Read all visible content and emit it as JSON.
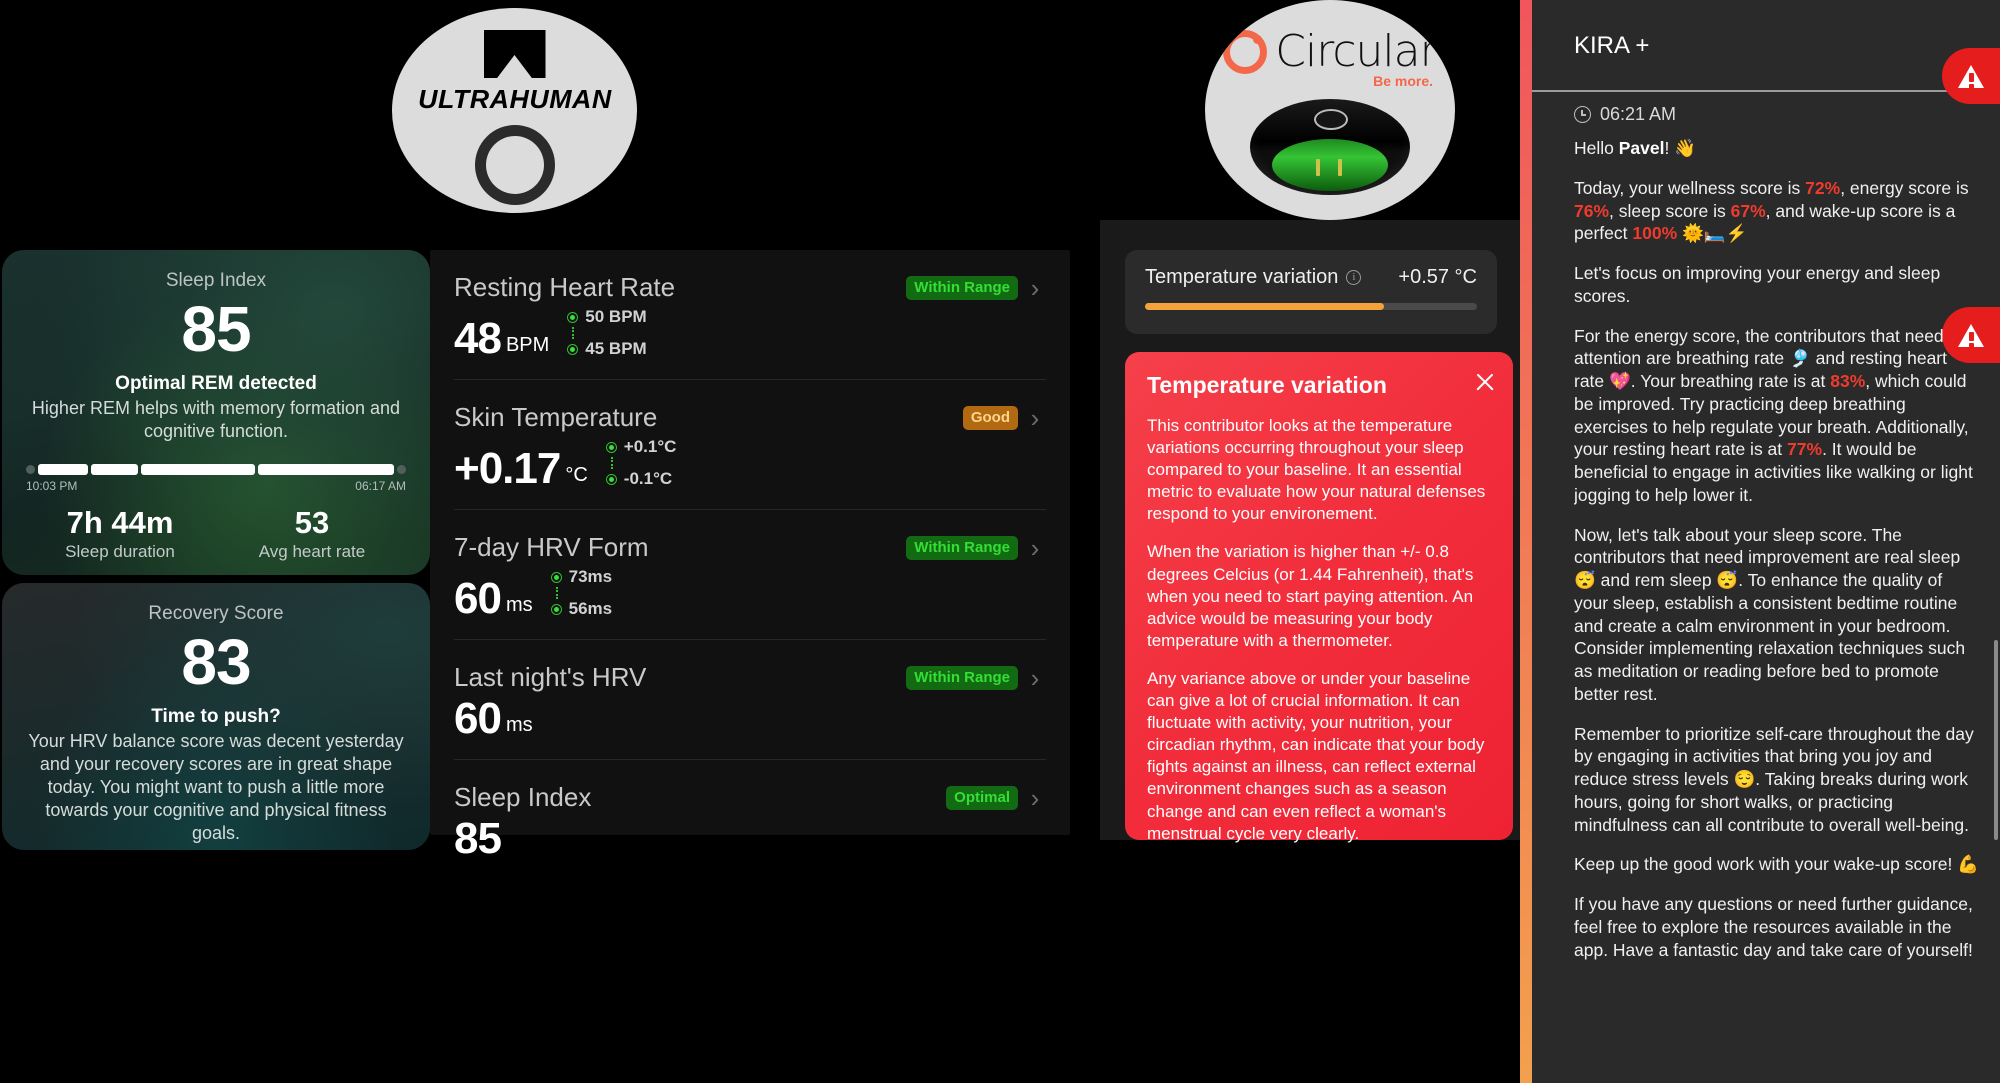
{
  "brands": {
    "ultrahuman": {
      "wordmark": "ULTRAHUMAN"
    },
    "circular": {
      "wordmark": "Circular",
      "tagline": "Be more."
    }
  },
  "sleep_card": {
    "title": "Sleep Index",
    "score": "85",
    "headline": "Optimal REM detected",
    "body": "Higher REM helps with memory formation and cognitive function.",
    "start_time": "10:03 PM",
    "end_time": "06:17 AM",
    "duration_value": "7h 44m",
    "duration_label": "Sleep duration",
    "avg_hr_value": "53",
    "avg_hr_label": "Avg heart rate"
  },
  "recovery_card": {
    "title": "Recovery Score",
    "score": "83",
    "headline": "Time to push?",
    "body": "Your HRV balance score was decent yesterday and your recovery scores are in great shape today. You might want to push a little more towards your cognitive and physical fitness goals."
  },
  "metrics": [
    {
      "name": "Resting Heart Rate",
      "badge": "Within Range",
      "badge_color": "green",
      "value": "48",
      "unit": "BPM",
      "range_high": "50 BPM",
      "range_low": "45 BPM"
    },
    {
      "name": "Skin Temperature",
      "badge": "Good",
      "badge_color": "amber",
      "value": "+0.17",
      "unit": "°C",
      "range_high": "+0.1°C",
      "range_low": "-0.1°C"
    },
    {
      "name": "7-day HRV Form",
      "badge": "Within Range",
      "badge_color": "green",
      "value": "60",
      "unit": "ms",
      "range_high": "73ms",
      "range_low": "56ms"
    },
    {
      "name": "Last night's HRV",
      "badge": "Within Range",
      "badge_color": "green",
      "value": "60",
      "unit": "ms",
      "range_high": "",
      "range_low": ""
    },
    {
      "name": "Sleep Index",
      "badge": "Optimal",
      "badge_color": "green",
      "value": "85",
      "unit": "",
      "range_high": "",
      "range_low": ""
    }
  ],
  "temperature": {
    "label": "Temperature variation",
    "value": "+0.57 °C",
    "fill_percent": 72,
    "accent_color": "#f5a23c",
    "info": {
      "title": "Temperature variation",
      "paragraph_1": "This contributor looks at the temperature variations occurring throughout your sleep compared to your baseline. It an essential metric to evaluate how your natural defenses respond to your environement.",
      "paragraph_2": "When the variation is higher than +/- 0.8 degrees Celcius (or 1.44 Fahrenheit), that's when you need to start paying attention. An advice would be measuring your body temperature with a thermometer.",
      "paragraph_3": "Any variance above or under your baseline can give a lot of crucial information. It can fluctuate with activity, your nutrition, your circadian rhythm, can indicate that your body fights against an illness, can reflect external environment changes such as a season change and can even reflect a woman's menstrual cycle very clearly.",
      "background_color": "#f22d3b"
    }
  },
  "kira": {
    "title": "KIRA +",
    "time": "06:21 AM",
    "greeting_prefix": "Hello ",
    "greeting_name": "Pavel",
    "greeting_suffix": "! 👋",
    "scores": {
      "wellness": "72%",
      "energy": "76%",
      "sleep": "67%",
      "wakeup": "100%",
      "breathing_rate": "83%",
      "resting_heart_rate": "77%"
    },
    "p_scores_a": "Today, your wellness score is ",
    "p_scores_b": ", energy score is ",
    "p_scores_c": ", sleep score is ",
    "p_scores_d": ", and wake-up score is a perfect ",
    "p_scores_e": " 🌞🛏️⚡",
    "p_focus": "Let's focus on improving your energy and sleep scores.",
    "p_energy_a": "For the energy score, the contributors that need attention are breathing rate 🎐 and resting heart rate 💖. Your breathing rate is at ",
    "p_energy_b": ", which could be improved. Try practicing deep breathing exercises to help regulate your breath. Additionally, your resting heart rate is at ",
    "p_energy_c": ". It would be beneficial to engage in activities like walking or light jogging to help lower it.",
    "p_sleep": "Now, let's talk about your sleep score. The contributors that need improvement are real sleep 😴 and rem sleep 😴. To enhance the quality of your sleep, establish a consistent bedtime routine and create a calm environment in your bedroom. Consider implementing relaxation techniques such as meditation or reading before bed to promote better rest.",
    "p_selfcare": "Remember to prioritize self-care throughout the day by engaging in activities that bring you joy and reduce stress levels 😌. Taking breaks during work hours, going for short walks, or practicing mindfulness can all contribute to overall well-being.",
    "p_keepup": "Keep up the good work with your wake-up score! 💪",
    "p_closing": "If you have any questions or need further guidance, feel free to explore the resources available in the app. Have a fantastic day and take care of yourself!",
    "accent_top_color": "#f0565c",
    "accent_bottom_color": "#f2a04e",
    "warning_color": "#e51d1d"
  }
}
